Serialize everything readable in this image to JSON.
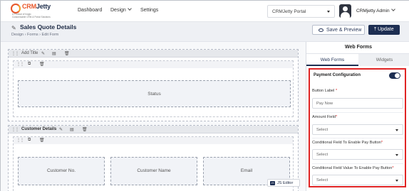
{
  "logo": {
    "brand_prefix": "CRM",
    "brand_suffix": "Jetty",
    "sub": "A Product of Inogic",
    "tagline": "Customizable CRM & Portal Solutions"
  },
  "nav": {
    "dashboard": "Dashboard",
    "design": "Design",
    "settings": "Settings"
  },
  "portal_select": {
    "value": "CRMJetty Portal"
  },
  "user": {
    "name": "CRMjetty Admin"
  },
  "page": {
    "title": "Sales Quote Details",
    "breadcrumb": {
      "a": "Design",
      "sep1": "›",
      "b": "Forms",
      "sep2": "›",
      "c": "Edit Form"
    },
    "save_preview": "Save & Preview",
    "update": "Update"
  },
  "canvas": {
    "section1": {
      "label": "Add Title",
      "field": "Status"
    },
    "section2": {
      "label": "Customer Details",
      "fields": [
        "Customer No.",
        "Customer Name",
        "Email"
      ]
    },
    "js_editor": "JS Editor",
    "js_icon": "JS"
  },
  "panel": {
    "title": "Web Forms",
    "tabs": [
      "Web Forms",
      "Widgets"
    ],
    "config": {
      "title": "Payment Configuration",
      "toggle_on": true,
      "button_label": {
        "label": "Button Label",
        "value": "Pay Now"
      },
      "amount_field": {
        "label": "Amount Field",
        "placeholder": "Select"
      },
      "conditional_field": {
        "label": "Conditional Field To Enable Pay Button",
        "placeholder": "Select"
      },
      "conditional_value": {
        "label": "Conditional Field Value To Enable Pay Button",
        "placeholder": "Select"
      }
    }
  },
  "colors": {
    "primary": "#1d2e52",
    "highlight": "#e02424",
    "accent": "#e8562a"
  }
}
